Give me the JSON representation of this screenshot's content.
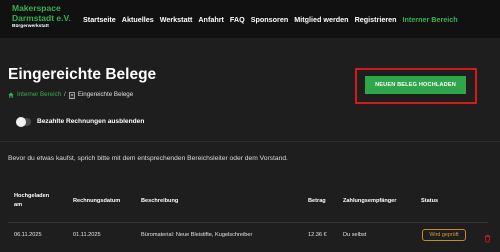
{
  "brand": {
    "line1": "Makerspace",
    "line2": "Darmstadt e.V.",
    "sub": "Bürgerwerkstatt"
  },
  "nav": {
    "items": [
      {
        "label": "Startseite"
      },
      {
        "label": "Aktuelles"
      },
      {
        "label": "Werkstatt"
      },
      {
        "label": "Anfahrt"
      },
      {
        "label": "FAQ"
      },
      {
        "label": "Sponsoren"
      },
      {
        "label": "Mitglied werden"
      },
      {
        "label": "Registrieren"
      },
      {
        "label": "Interner Bereich"
      }
    ],
    "active_index": 8
  },
  "page": {
    "title": "Eingereichte Belege",
    "upload_button": "NEUEN BELEG HOCHLADEN"
  },
  "breadcrumb": {
    "home": "Interner Bereich",
    "separator": "/",
    "current": "Eingereichte Belege"
  },
  "filter": {
    "toggle_label": "Bezahlte Rechnungen ausblenden",
    "enabled": false
  },
  "info_text": "Bevor du etwas kaufst, sprich bitte mit dem entsprechenden Bereichsleiter oder dem Vorstand.",
  "table": {
    "headers": {
      "uploaded_line1": "Hochgeladen",
      "uploaded_line2": "am",
      "invoice_date": "Rechnungsdatum",
      "description": "Beschreibung",
      "amount": "Betrag",
      "recipient": "Zahlungsempfänger",
      "status": "Status"
    },
    "rows": [
      {
        "uploaded": "06.11.2025",
        "invoice_date": "01.11.2025",
        "description": "Büromaterial: Neue Bleistifte, Kugelschreiber",
        "amount": "12.36 €",
        "recipient": "Du selbst",
        "status": "Wird geprüft"
      }
    ]
  },
  "colors": {
    "accent": "#37b04f",
    "highlight_frame": "#d11a1a",
    "status_pending": "#d89a3a",
    "background": "#1e1e1e",
    "nav_background": "#111111"
  },
  "icons": {
    "breadcrumb_home": "home-icon",
    "breadcrumb_current": "receipt-icon",
    "delete": "trash-icon"
  }
}
